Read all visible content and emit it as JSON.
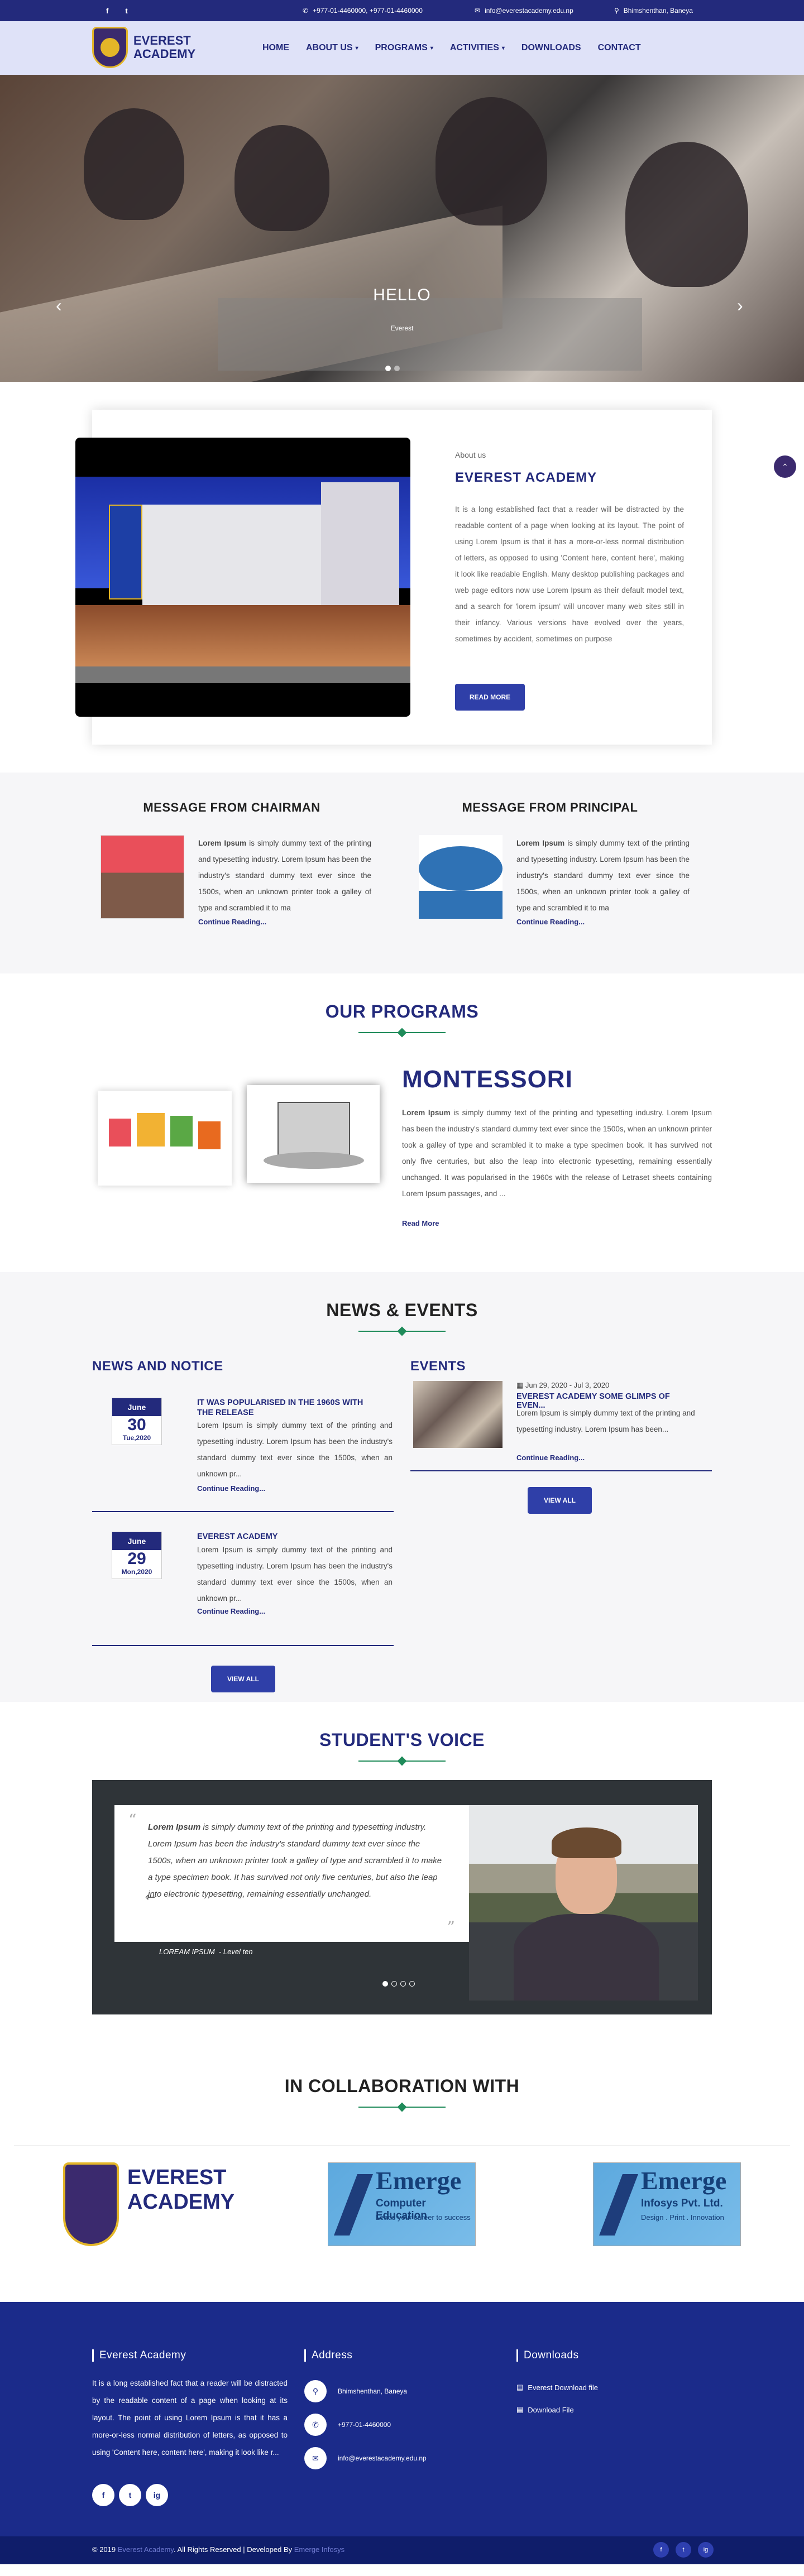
{
  "topbar": {
    "social": [
      "f",
      "t"
    ],
    "phone": "+977-01-4460000, +977-01-4460000",
    "email": "info@everestacademy.edu.np",
    "address": "Bhimshenthan, Baneya"
  },
  "header": {
    "logo_line1": "EVEREST",
    "logo_line2": "ACADEMY",
    "nav": [
      {
        "label": "HOME",
        "caret": false
      },
      {
        "label": "ABOUT US",
        "caret": true
      },
      {
        "label": "PROGRAMS",
        "caret": true
      },
      {
        "label": "ACTIVITIES",
        "caret": true
      },
      {
        "label": "DOWNLOADS",
        "caret": false
      },
      {
        "label": "CONTACT",
        "caret": false
      }
    ]
  },
  "hero": {
    "title": "HELLO",
    "subtitle": "Everest",
    "slide_count": 2,
    "active_slide": 1
  },
  "about": {
    "label": "About us",
    "title": "EVEREST ACADEMY",
    "text": "It is a long established fact that a reader will be distracted by the readable content of a page when looking at its layout. The point of using Lorem Ipsum is that it has a more-or-less normal distribution of letters, as opposed to using 'Content here, content here', making it look like readable English. Many desktop publishing packages and web page editors now use Lorem Ipsum as their default model text, and a search for 'lorem ipsum' will uncover many web sites still in their infancy. Various versions have evolved over the years, sometimes by accident, sometimes on purpose",
    "button": "READ MORE"
  },
  "messages": {
    "chairman": {
      "title": "MESSAGE FROM CHAIRMAN",
      "lead": "Lorem Ipsum",
      "text": " is simply dummy text of the printing and typesetting industry. Lorem Ipsum has been the industry's standard dummy text ever since the 1500s, when an unknown printer took a galley of type and scrambled it to ma",
      "more": "Continue Reading..."
    },
    "principal": {
      "title": "MESSAGE FROM PRINCIPAL",
      "lead": "Lorem Ipsum",
      "text": " is simply dummy text of the printing and typesetting industry. Lorem Ipsum has been the industry's standard dummy text ever since the 1500s, when an unknown printer took a galley of type and scrambled it to ma",
      "more": "Continue Reading..."
    }
  },
  "programs": {
    "section_title": "OUR PROGRAMS",
    "title": "MONTESSORI",
    "lead": "Lorem Ipsum",
    "text": " is simply dummy text of the printing and typesetting industry. Lorem Ipsum has been the industry's standard dummy text ever since the 1500s, when an unknown printer took a galley of type and scrambled it to make a type specimen book. It has survived not only five centuries, but also the leap into electronic typesetting, remaining essentially unchanged. It was popularised in the 1960s with the release of Letraset sheets containing Lorem Ipsum passages, and ...",
    "more": "Read More"
  },
  "news": {
    "section_title": "NEWS & EVENTS",
    "news_heading": "NEWS AND NOTICE",
    "events_heading": "EVENTS",
    "items": [
      {
        "month": "June",
        "day": "30",
        "dow": "Tue,2020",
        "title": "IT WAS POPULARISED IN THE 1960S WITH THE RELEASE",
        "body": "Lorem Ipsum is simply dummy text of the printing and typesetting industry. Lorem Ipsum has been the industry's standard dummy text ever since the 1500s, when an unknown pr...",
        "more": "Continue Reading..."
      },
      {
        "month": "June",
        "day": "29",
        "dow": "Mon,2020",
        "title": "EVEREST ACADEMY",
        "body": "Lorem Ipsum is simply dummy text of the printing and typesetting industry. Lorem Ipsum has been the industry's standard dummy text ever since the 1500s, when an unknown pr...",
        "more": "Continue Reading..."
      }
    ],
    "view_all": "VIEW ALL",
    "event": {
      "date": "Jun 29, 2020 - Jul 3, 2020",
      "title": "EVEREST ACADEMY SOME GLIMPS OF EVEN...",
      "body": "Lorem Ipsum is simply dummy text of the printing and typesetting industry. Lorem Ipsum has been...",
      "more": "Continue Reading..."
    },
    "events_view_all": "VIEW ALL"
  },
  "voice": {
    "section_title": "STUDENT'S VOICE",
    "lead": "Lorem Ipsum",
    "quote": " is simply dummy text of the printing and typesetting industry. Lorem Ipsum has been the industry's standard dummy text ever since the 1500s, when an unknown printer took a galley of type and scrambled it to make a type specimen book. It has survived not only five centuries, but also the leap into electronic typesetting, remaining essentially unchanged.",
    "name": "LOREAM IPSUM",
    "level": "- Level ten",
    "slide_count": 4,
    "active_slide": 1
  },
  "collab": {
    "section_title": "IN COLLABORATION WITH",
    "partners": [
      {
        "line1": "EVEREST",
        "line2": "ACADEMY"
      },
      {
        "big": "Emerge",
        "small": "Computer Education",
        "tiny": "Leads your career to success"
      },
      {
        "big": "Emerge",
        "small": "Infosys Pvt. Ltd.",
        "tiny": "Design . Print . Innovation"
      }
    ]
  },
  "footer": {
    "about_head": "Everest Academy",
    "about_text": "It is a long established fact that a reader will be distracted by the readable content of a page when looking at its layout. The point of using Lorem Ipsum is that it has a more-or-less normal distribution of letters, as opposed to using 'Content here, content here', making it look like r...",
    "social": [
      "f",
      "t",
      "ig"
    ],
    "address_head": "Address",
    "address": "Bhimshenthan, Baneya",
    "phone": "+977-01-4460000",
    "email": "info@everestacademy.edu.np",
    "downloads_head": "Downloads",
    "downloads": [
      "Everest Download file",
      "Download File"
    ],
    "copy_prefix": "© 2019 ",
    "copy_site": "Everest Academy",
    "copy_mid": ". All Rights Reserved | Developed By ",
    "copy_dev": "Emerge Infosys",
    "bottom_social": [
      "f",
      "t",
      "ig"
    ]
  }
}
